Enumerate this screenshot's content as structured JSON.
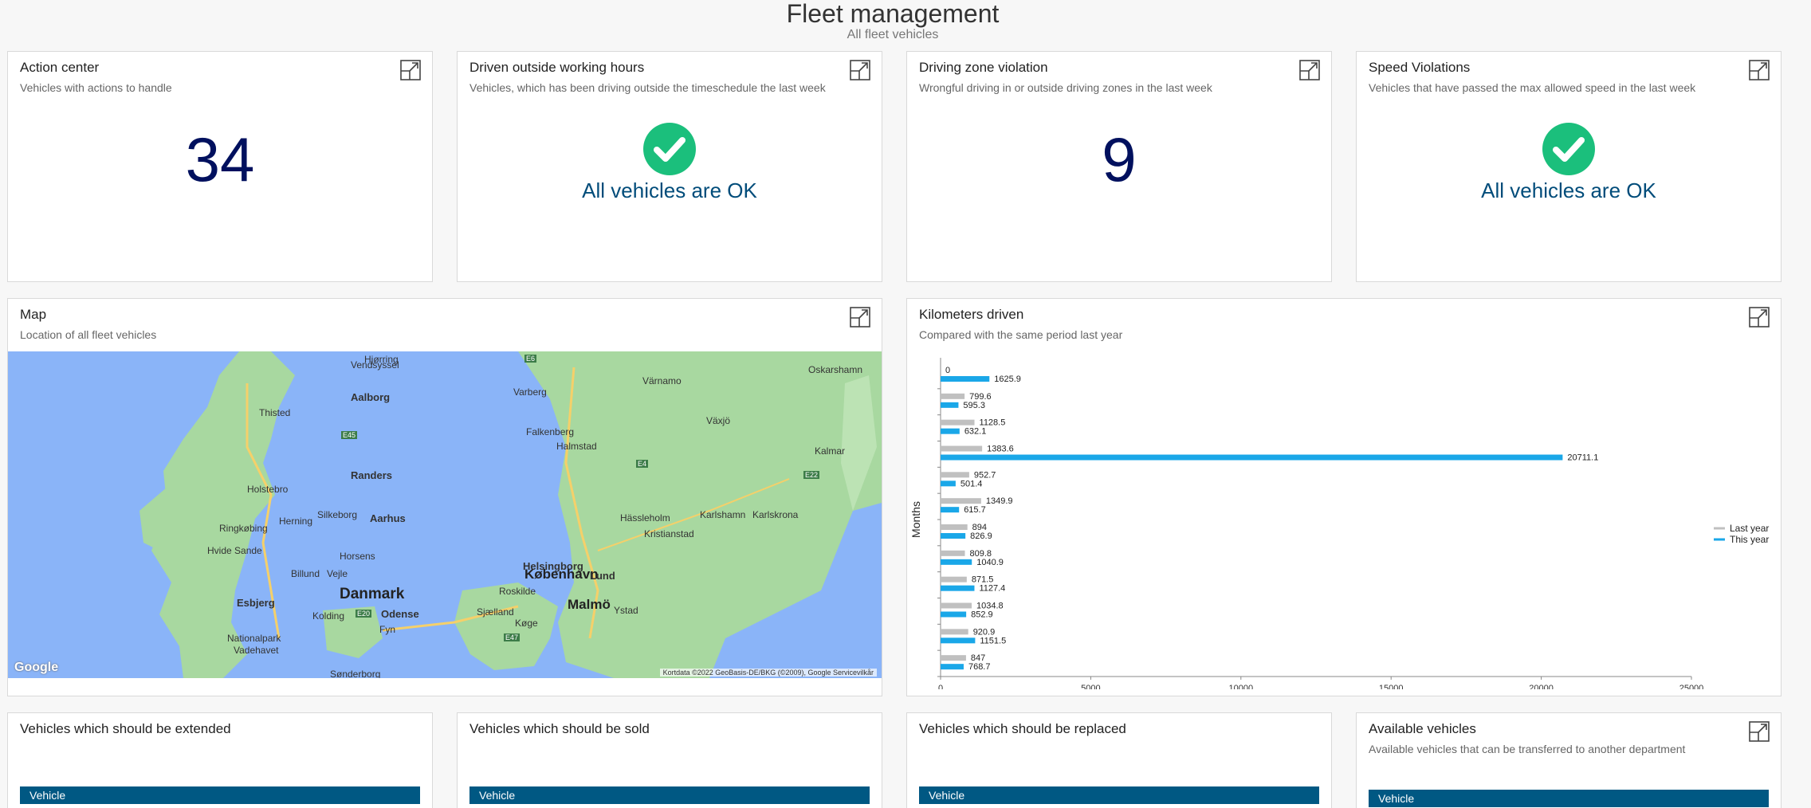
{
  "header": {
    "title": "Fleet management",
    "subtitle": "All fleet vehicles"
  },
  "cards": {
    "action_center": {
      "title": "Action center",
      "subtitle": "Vehicles with actions to handle",
      "value": "34"
    },
    "outside_hours": {
      "title": "Driven outside working hours",
      "subtitle": "Vehicles, which has been driving outside the timeschedule the last week",
      "status": "All vehicles are OK"
    },
    "zone_violation": {
      "title": "Driving zone violation",
      "subtitle": "Wrongful driving in or outside driving zones in the last week",
      "value": "9"
    },
    "speed_violations": {
      "title": "Speed Violations",
      "subtitle": "Vehicles that have passed the max allowed speed in the last week",
      "status": "All vehicles are OK"
    },
    "map": {
      "title": "Map",
      "subtitle": "Location of all fleet vehicles"
    },
    "kilometers": {
      "title": "Kilometers driven",
      "subtitle": "Compared with the same period last year"
    },
    "extended": {
      "title": "Vehicles which should be extended",
      "column": "Vehicle"
    },
    "sold": {
      "title": "Vehicles which should be sold",
      "column": "Vehicle"
    },
    "replaced": {
      "title": "Vehicles which should be replaced",
      "column": "Vehicle"
    },
    "available": {
      "title": "Available vehicles",
      "subtitle": "Available vehicles that can be transferred to another department",
      "column": "Vehicle"
    }
  },
  "map_labels": {
    "danmark": "Danmark",
    "kobenhavn": "København",
    "malmo": "Malmö",
    "aalborg": "Aalborg",
    "aarhus": "Aarhus",
    "randers": "Randers",
    "odense": "Odense",
    "esbjerg": "Esbjerg",
    "vejle": "Vejle",
    "horsens": "Horsens",
    "herning": "Herning",
    "silkeborg": "Silkeborg",
    "holstebro": "Holstebro",
    "thisted": "Thisted",
    "ringkobing": "Ringkøbing",
    "hvidesande": "Hvide Sande",
    "billund": "Billund",
    "kolding": "Kolding",
    "fyn": "Fyn",
    "nationalpark": "Nationalpark",
    "vadehavet": "Vadehavet",
    "sonderborg": "Sønderborg",
    "vendsyssel": "Vendsyssel",
    "hjorring": "Hjørring",
    "helsingborg": "Helsingborg",
    "lund": "Lund",
    "roskilde": "Roskilde",
    "sjaelland": "Sjælland",
    "koge": "Køge",
    "ystad": "Ystad",
    "kristianstad": "Kristianstad",
    "hassleholm": "Hässleholm",
    "karlshamn": "Karlshamn",
    "karlskrona": "Karlskrona",
    "halmstad": "Halmstad",
    "falkenberg": "Falkenberg",
    "varberg": "Varberg",
    "varnamo": "Värnamo",
    "vaxjo": "Växjö",
    "kalmar": "Kalmar",
    "oskarshamn": "Oskarshamn",
    "e6": "E6",
    "e4": "E4",
    "e22": "E22",
    "e45": "E45",
    "e20": "E20",
    "e47": "E47",
    "logo": "Google",
    "attribution": "Kortdata ©2022 GeoBasis-DE/BKG (©2009), Google   Servicevilkår"
  },
  "colors": {
    "last_year": "#c0c0c0",
    "this_year": "#1aa7e8",
    "header_blue": "#005883",
    "number_navy": "#00105e",
    "ok_green": "#1bbf7c"
  },
  "icons": {
    "expand": "expand-icon",
    "ok": "check-circle-icon"
  },
  "chart_data": {
    "type": "bar",
    "orientation": "horizontal",
    "ylabel": "Months",
    "xlim": [
      0,
      25000
    ],
    "xticks": [
      "0",
      "5000",
      "10000",
      "15000",
      "20000",
      "25000"
    ],
    "legend_position": "right",
    "series": [
      {
        "name": "Last year",
        "values": [
          0,
          799.6,
          1128.5,
          1383.6,
          952.7,
          1349.9,
          894,
          809.8,
          871.5,
          1034.8,
          920.9,
          847
        ]
      },
      {
        "name": "This year",
        "values": [
          1625.9,
          595.3,
          632.1,
          20711.1,
          501.4,
          615.7,
          826.9,
          1040.9,
          1127.4,
          852.9,
          1151.5,
          768.7
        ]
      }
    ],
    "labels": [
      [
        "0",
        "1625.9"
      ],
      [
        "799.6",
        "595.3"
      ],
      [
        "1128.5",
        "632.1"
      ],
      [
        "1383.6",
        "20711.1"
      ],
      [
        "952.7",
        "501.4"
      ],
      [
        "1349.9",
        "615.7"
      ],
      [
        "894",
        "826.9"
      ],
      [
        "809.8",
        "1040.9"
      ],
      [
        "871.5",
        "1127.4"
      ],
      [
        "1034.8",
        "852.9"
      ],
      [
        "920.9",
        "1151.5"
      ],
      [
        "847",
        "768.7"
      ]
    ]
  }
}
